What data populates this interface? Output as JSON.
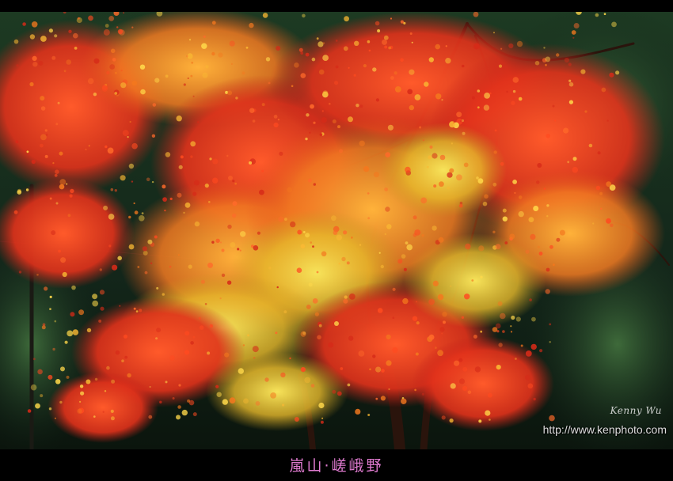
{
  "photo": {
    "description_icon": "autumn-maple-photo",
    "signature": "Kenny Wu",
    "watermark_url": "http://www.kenphoto.com"
  },
  "caption": {
    "text": "嵐山‧嵯峨野",
    "color": "#e07bd0"
  },
  "colors": {
    "frame": "#000000",
    "foliage_red": "#e8351c",
    "foliage_orange": "#f0821e",
    "foliage_yellow": "#e8c22a",
    "forest_dark": "#13261a"
  }
}
